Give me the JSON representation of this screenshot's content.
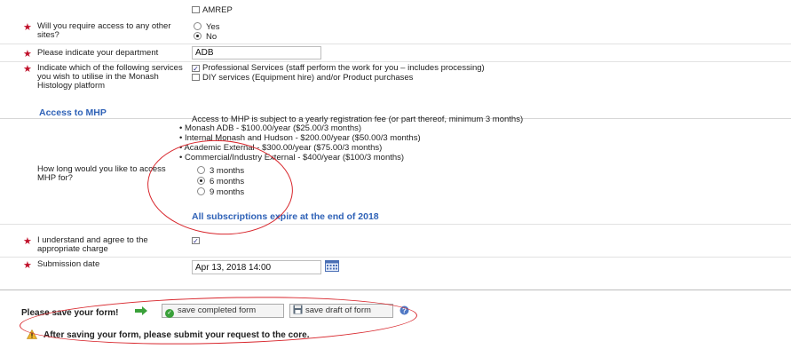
{
  "form": {
    "site_options": {
      "amrep": "AMREP"
    },
    "other_sites": {
      "label": "Will you require access to any other sites?",
      "options": [
        "Yes",
        "No"
      ],
      "selected": "No"
    },
    "department": {
      "label": "Please indicate your department",
      "value": "ADB"
    },
    "services": {
      "label": "Indicate which of the following services you wish to utilise in the Monash Histology platform",
      "options": [
        "Professional Services (staff perform the work for you – includes processing)",
        "DIY services (Equipment hire) and/or Product purchases"
      ],
      "checked": [
        true,
        false
      ]
    },
    "access_section": {
      "title": "Access to MHP",
      "intro": "Access to MHP is subject to a yearly registration fee (or part thereof, minimum 3 months)",
      "fees": [
        "Monash ADB - $100.00/year ($25.00/3 months)",
        "Internal Monash and Hudson - $200.00/year ($50.00/3 months)",
        "Academic External - $300.00/year ($75.00/3 months)",
        "Commercial/Industry External - $400/year ($100/3 months)"
      ]
    },
    "duration": {
      "label": "How long would you like to access MHP for?",
      "options": [
        "3 months",
        "6 months",
        "9 months"
      ],
      "selected": "6 months"
    },
    "expiry_note": "All subscriptions expire at the end of 2018",
    "agree": {
      "label": "I understand and agree to the appropriate charge",
      "checked": true
    },
    "submission_date": {
      "label": "Submission date",
      "value": "Apr 13, 2018 14:00"
    }
  },
  "footer": {
    "save_prompt": "Please save your form!",
    "save_completed_label": "save completed form",
    "save_draft_label": "save draft of form",
    "warning_text": "After saving your form, please submit your request to the core."
  },
  "colors": {
    "required_star": "#c0102a",
    "section_title": "#2f62b7",
    "annotation_ellipse": "#d8262c",
    "green_arrow": "#3aa13a"
  },
  "icons": [
    "star-icon",
    "calendar-icon",
    "arrow-right-icon",
    "check-circle-icon",
    "floppy-disk-icon",
    "help-icon",
    "warning-icon"
  ]
}
